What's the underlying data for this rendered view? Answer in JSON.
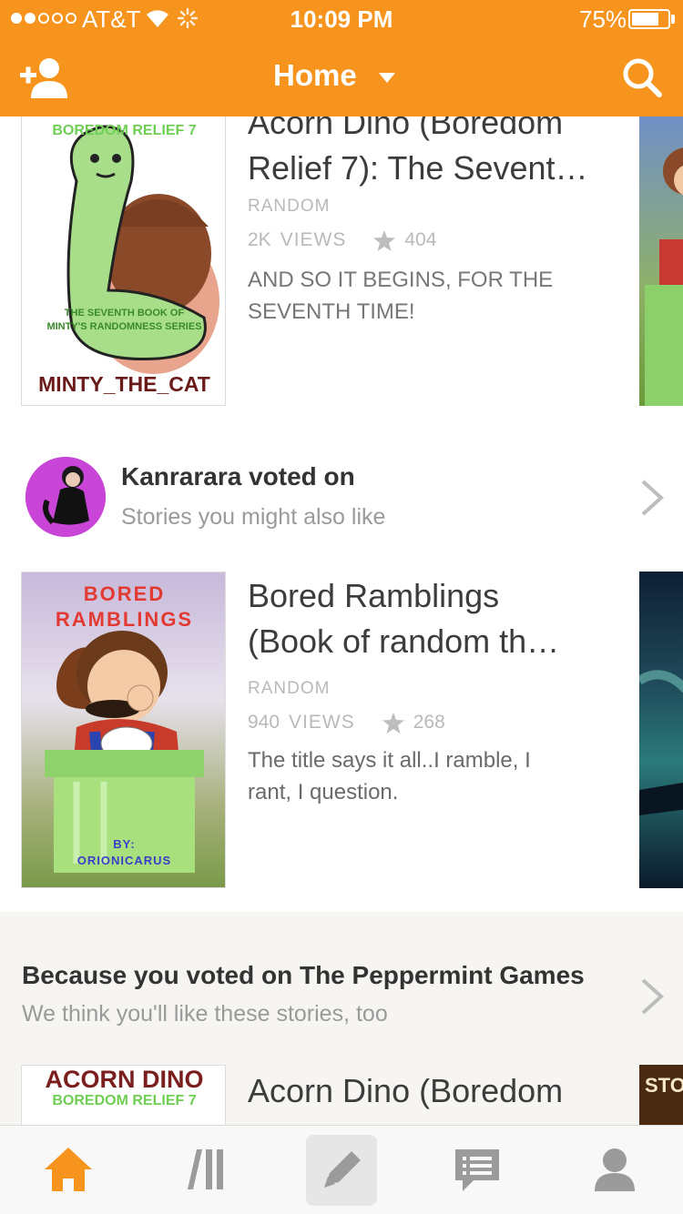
{
  "status_bar": {
    "carrier": "AT&T",
    "time": "10:09 PM",
    "battery": "75%",
    "battery_level": 0.75
  },
  "header": {
    "title": "Home",
    "icons": [
      "add-friend-icon",
      "chevron-down-icon",
      "search-icon"
    ]
  },
  "stories": [
    {
      "title_lines": [
        "Acorn Dino (Boredom",
        "Relief 7): The Sevent…"
      ],
      "genre": "RANDOM",
      "views": "2K",
      "views_label": "VIEWS",
      "votes": "404",
      "description_lines": [
        "AND SO IT BEGINS, FOR THE",
        "SEVENTH TIME!"
      ],
      "cover": {
        "top_text": "BOREDOM RELIEF 7",
        "middle_text_lines": [
          "THE SEVENTH BOOK OF",
          "MINTY'S RANDOMNESS SERIES"
        ],
        "author": "MINTY_THE_CAT"
      }
    },
    {
      "title_lines": [
        "Bored Ramblings",
        "(Book of random th…"
      ],
      "genre": "RANDOM",
      "views": "940",
      "views_label": "VIEWS",
      "votes": "268",
      "description_lines": [
        "The title says it all..I ramble, I",
        "rant, I question."
      ],
      "cover": {
        "title_lines": [
          "BORED",
          "RAMBLINGS"
        ],
        "by_label": "BY:",
        "author": "ORIONICARUS"
      }
    },
    {
      "title_lines": [
        "Acorn Dino (Boredom"
      ],
      "cover": {
        "top_text": "ACORN DINO",
        "sub_text": "BOREDOM RELIEF 7"
      },
      "right_cover_text": "STO"
    }
  ],
  "activity": {
    "voter_line": "Kanrarara voted on",
    "subtitle": "Stories you might also like"
  },
  "recommendation": {
    "heading": "Because you voted on The Peppermint Games",
    "subtitle": "We think you'll like these stories, too"
  },
  "tab_bar": {
    "tabs": [
      "home-icon",
      "library-icon",
      "write-icon",
      "messages-icon",
      "profile-icon"
    ],
    "active_color": "#f7941e",
    "inactive_color": "#9b9b9b"
  },
  "colors": {
    "accent": "#f7941e"
  }
}
